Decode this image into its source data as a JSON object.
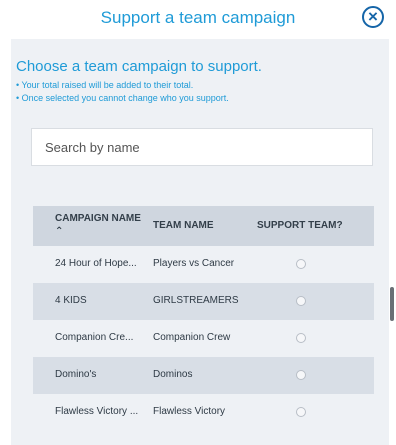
{
  "modal": {
    "title": "Support a team campaign",
    "close_glyph": "×",
    "close_icon": "close-circle-icon"
  },
  "instructions": {
    "heading": "Choose a team campaign to support.",
    "bullets": [
      "• Your total raised will be added to their total.",
      "• Once selected you cannot change who you support."
    ]
  },
  "search": {
    "placeholder": "Search by name",
    "value": ""
  },
  "table": {
    "headers": {
      "campaign": "CAMPAIGN NAME",
      "sort_indicator": "⌃",
      "team": "TEAM NAME",
      "support": "SUPPORT TEAM?"
    },
    "rows": [
      {
        "campaign": "24 Hour of Hope...",
        "team": "Players vs Cancer",
        "selected": false
      },
      {
        "campaign": "4 KIDS",
        "team": "GIRLSTREAMERS",
        "selected": false
      },
      {
        "campaign": "Companion Cre...",
        "team": "Companion Crew",
        "selected": false
      },
      {
        "campaign": "Domino's",
        "team": "Dominos",
        "selected": false
      },
      {
        "campaign": "Flawless Victory ...",
        "team": "Flawless Victory",
        "selected": false
      }
    ]
  },
  "colors": {
    "accent": "#1f9bd7",
    "close": "#1565a8",
    "header_bg": "#cfd6df",
    "row_alt": "#d8dee6",
    "panel_bg": "#eef1f5"
  }
}
